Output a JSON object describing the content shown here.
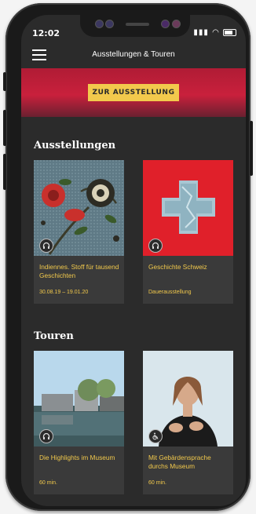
{
  "status": {
    "time": "12:02"
  },
  "header": {
    "title": "Ausstellungen & Touren"
  },
  "hero": {
    "button_label": "ZUR AUSSTELLUNG"
  },
  "sections": {
    "exhibitions": {
      "title": "Ausstellungen",
      "cards": [
        {
          "title": "Indiennes. Stoff für tausend Geschichten",
          "meta": "30.08.19 – 19.01.20",
          "icon": "headphones-icon"
        },
        {
          "title": "Geschichte Schweiz",
          "meta": "Dauerausstellung",
          "icon": "headphones-icon"
        }
      ]
    },
    "tours": {
      "title": "Touren",
      "cards": [
        {
          "title": "Die Highlights im Museum",
          "meta": "60 min.",
          "icon": "headphones-icon"
        },
        {
          "title": "Mit Gebärdensprache durchs Museum",
          "meta": "60 min.",
          "icon": "wheelchair-icon"
        }
      ]
    }
  },
  "colors": {
    "accent": "#f2c94c",
    "hero_red": "#c9203c",
    "background": "#2b2b2b",
    "card": "#3a3a3a"
  }
}
